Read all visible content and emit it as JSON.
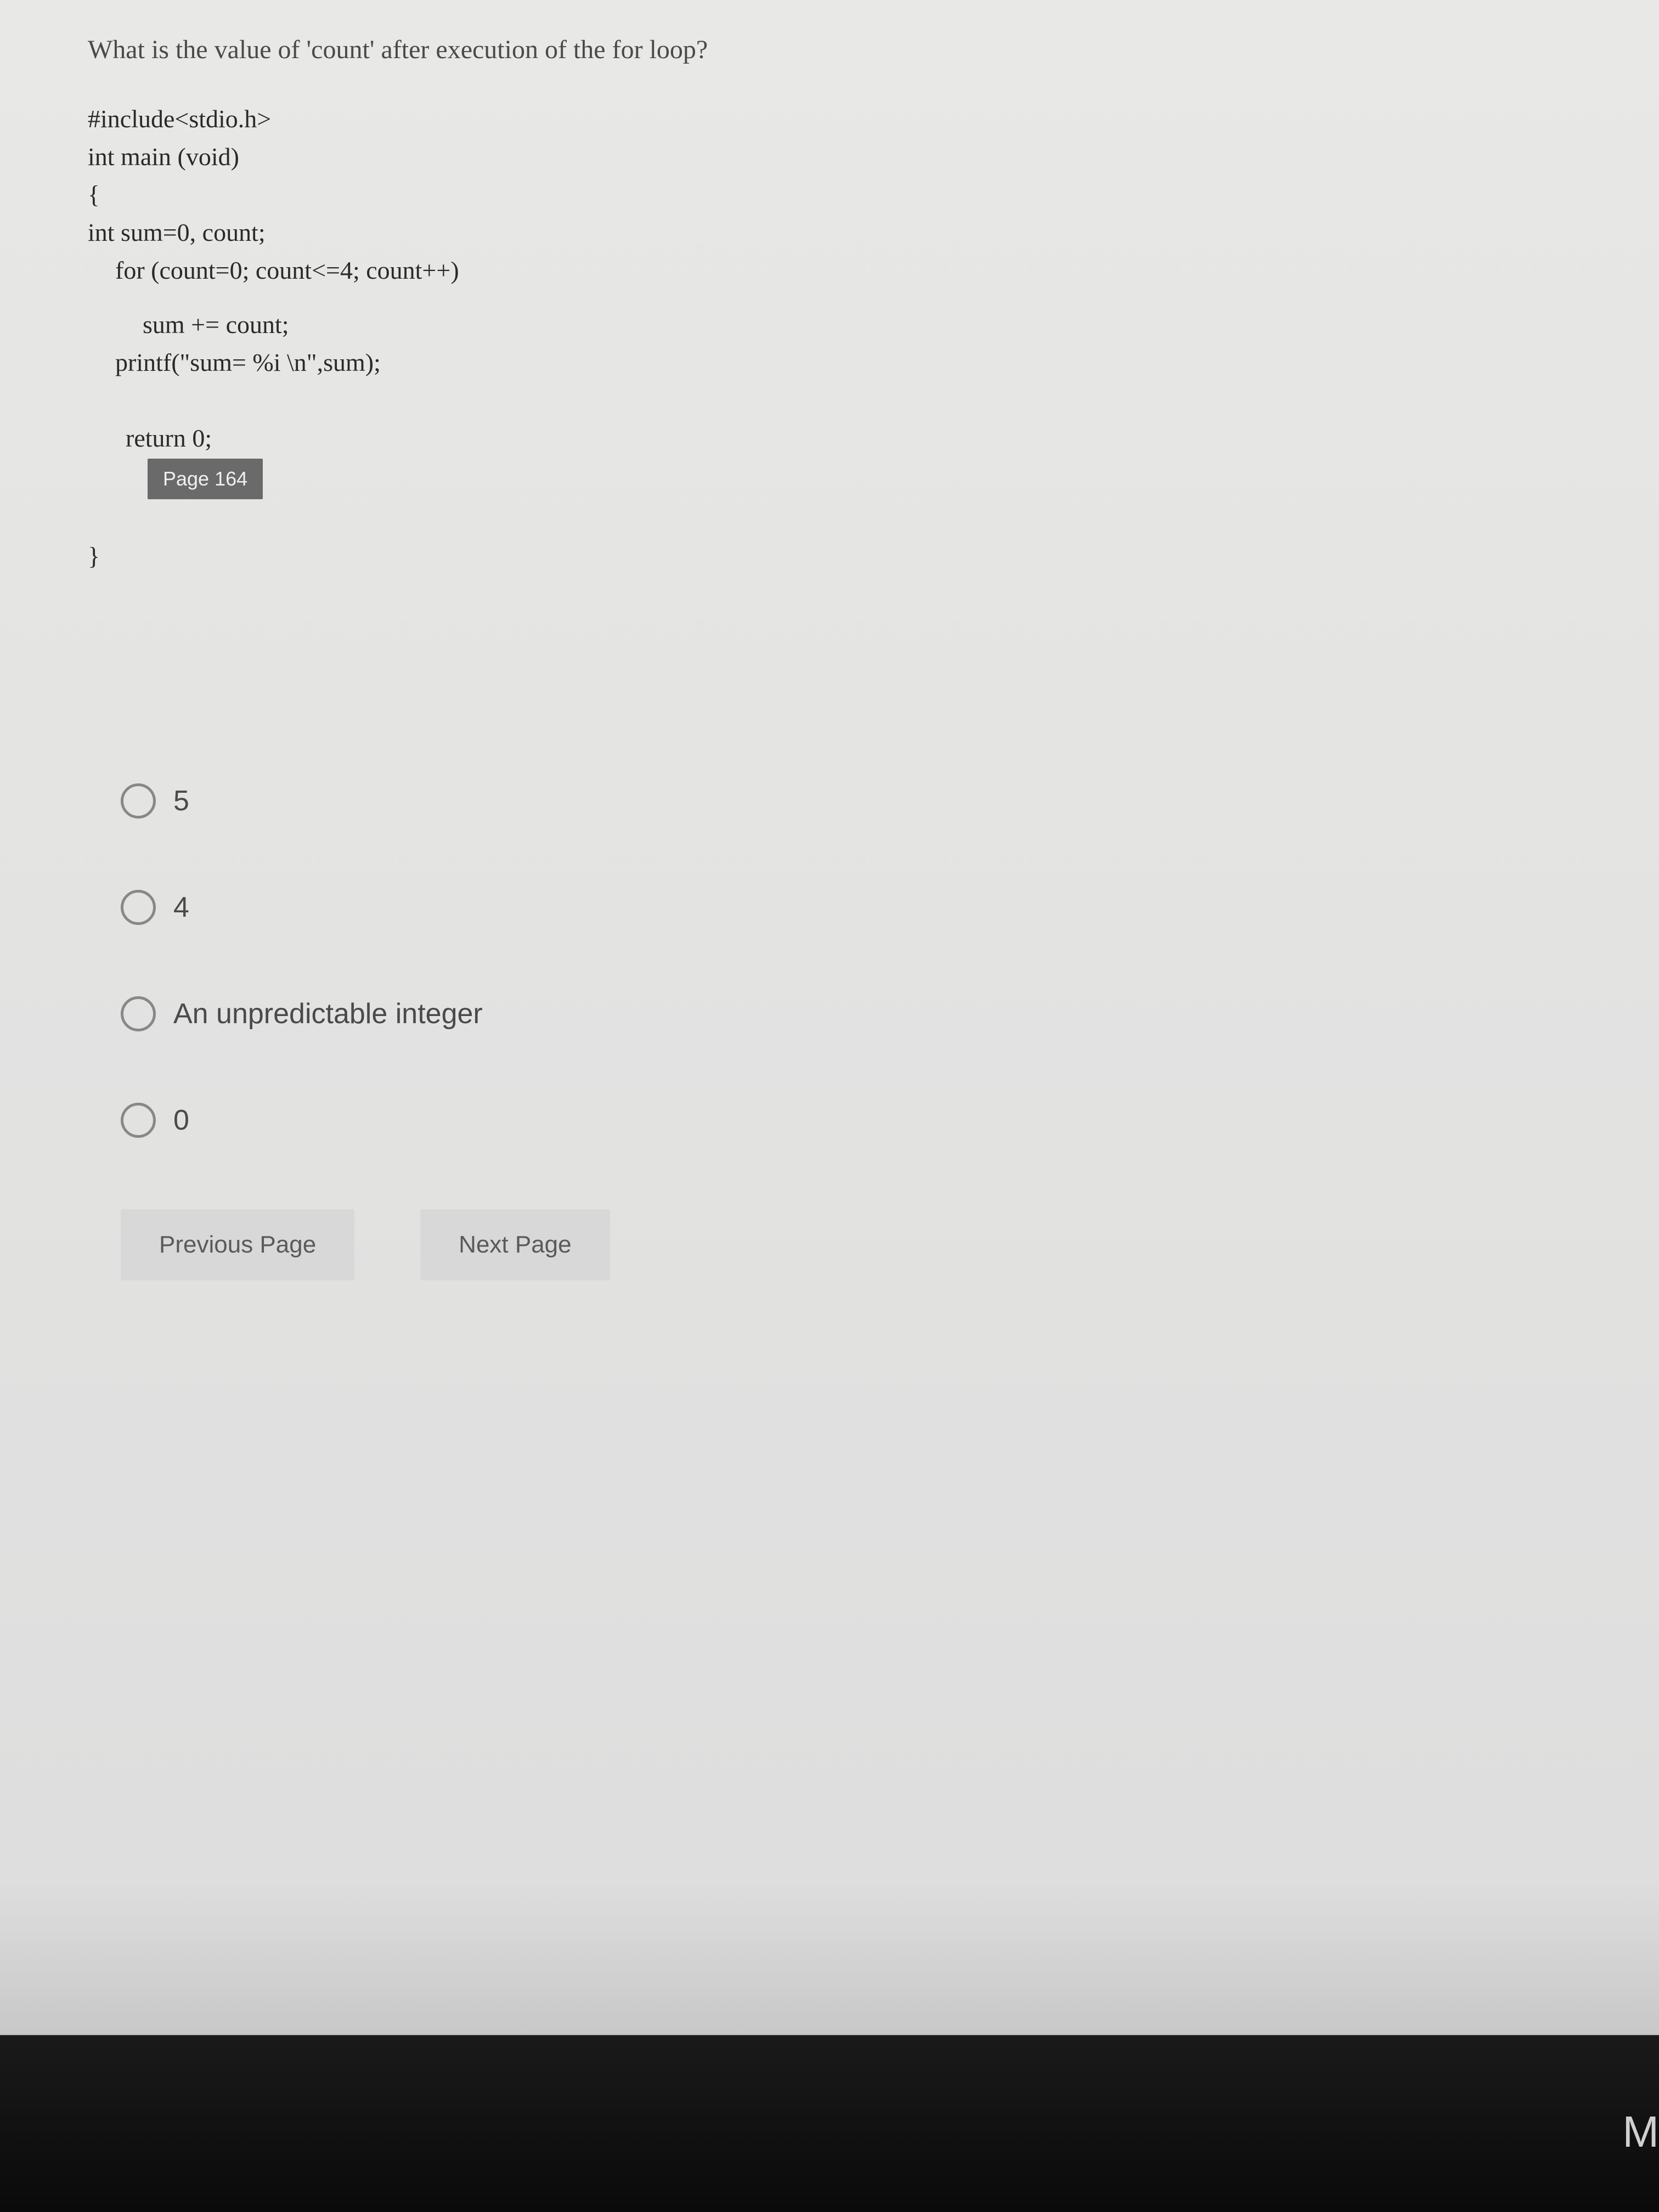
{
  "question": {
    "prompt": "What is the value of 'count' after execution of the for loop?",
    "code": {
      "line1": "#include<stdio.h>",
      "line2": "int main (void)",
      "line3": "{",
      "line4": "int sum=0, count;",
      "line5": "for (count=0; count<=4; count++)",
      "line6": "sum += count;",
      "line7": "printf(\"sum= %i \\n\",sum);",
      "line8": "return 0;",
      "line9": "}"
    },
    "tooltip": "Page 164"
  },
  "options": [
    {
      "label": "5"
    },
    {
      "label": "4"
    },
    {
      "label": "An unpredictable integer"
    },
    {
      "label": "0"
    }
  ],
  "nav": {
    "prev": "Previous Page",
    "next": "Next Page"
  },
  "corner": "M"
}
